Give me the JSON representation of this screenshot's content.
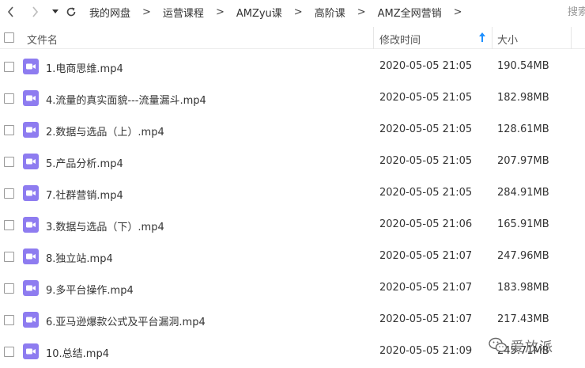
{
  "toolbar": {
    "breadcrumb": [
      "我的网盘",
      "运营课程",
      "AMZyu课",
      "高阶课",
      "AMZ全网营销"
    ],
    "search_placeholder": "搜索",
    "separator": ">"
  },
  "columns": {
    "name": "文件名",
    "time": "修改时间",
    "size": "大小"
  },
  "files": [
    {
      "name": "1.电商思维.mp4",
      "time": "2020-05-05 21:05",
      "size": "190.54MB"
    },
    {
      "name": "4.流量的真实面貌---流量漏斗.mp4",
      "time": "2020-05-05 21:05",
      "size": "182.98MB"
    },
    {
      "name": "2.数据与选品（上）.mp4",
      "time": "2020-05-05 21:05",
      "size": "128.61MB"
    },
    {
      "name": "5.产品分析.mp4",
      "time": "2020-05-05 21:05",
      "size": "207.97MB"
    },
    {
      "name": "7.社群营销.mp4",
      "time": "2020-05-05 21:05",
      "size": "284.91MB"
    },
    {
      "name": "3.数据与选品（下）.mp4",
      "time": "2020-05-05 21:06",
      "size": "165.91MB"
    },
    {
      "name": "8.独立站.mp4",
      "time": "2020-05-05 21:07",
      "size": "247.96MB"
    },
    {
      "name": "9.多平台操作.mp4",
      "time": "2020-05-05 21:07",
      "size": "183.98MB"
    },
    {
      "name": "6.亚马逊爆款公式及平台漏洞.mp4",
      "time": "2020-05-05 21:07",
      "size": "217.43MB"
    },
    {
      "name": "10.总结.mp4",
      "time": "2020-05-05 21:09",
      "size": "245.71MB"
    }
  ],
  "watermark": {
    "text": "爱放派"
  },
  "colors": {
    "video_icon": "#8e7cf0",
    "sort_arrow": "#1e90ff"
  },
  "icons": {
    "file": "video-file-icon",
    "back": "chevron-left-icon",
    "forward": "chevron-right-icon",
    "dropdown": "caret-down-icon",
    "refresh": "refresh-icon"
  }
}
